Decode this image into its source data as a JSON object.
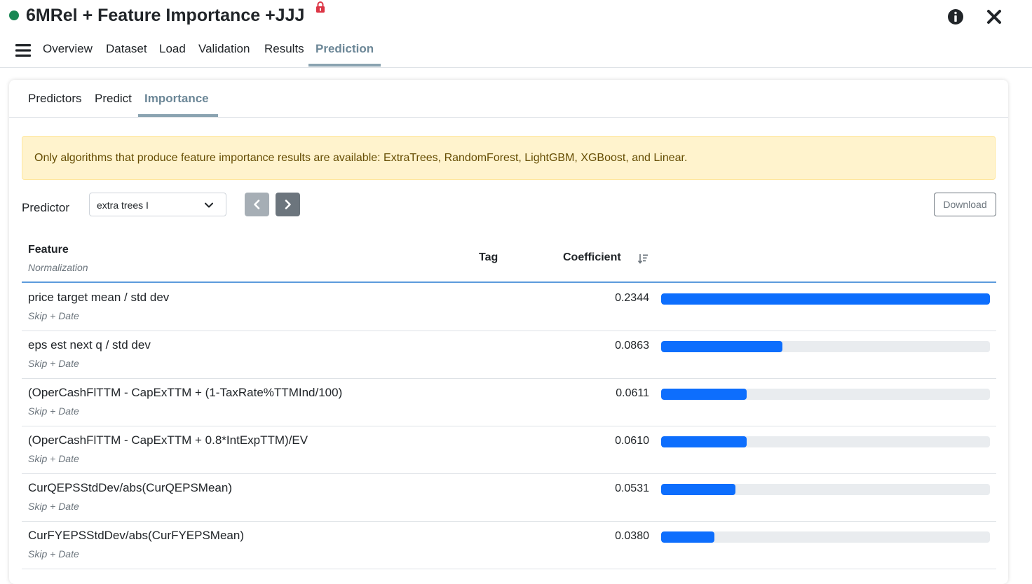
{
  "app": {
    "title": "6MRel + Feature Importance +JJJ",
    "status_color": "#198754",
    "icons": [
      "lock-icon",
      "info-icon",
      "close-icon",
      "menu-icon"
    ]
  },
  "main_nav": {
    "tabs": [
      {
        "label": "Overview"
      },
      {
        "label": "Dataset"
      },
      {
        "label": "Load"
      },
      {
        "label": "Validation"
      },
      {
        "label": "Results"
      },
      {
        "label": "Prediction",
        "active": true
      }
    ]
  },
  "sub_nav": {
    "tabs": [
      {
        "label": "Predictors"
      },
      {
        "label": "Predict"
      },
      {
        "label": "Importance",
        "active": true
      }
    ]
  },
  "alert": {
    "text": "Only algorithms that produce feature importance results are available: ExtraTrees, RandomForest, LightGBM, XGBoost, and Linear."
  },
  "controls": {
    "predictor_label": "Predictor",
    "predictor_value": "extra trees I",
    "download_label": "Download"
  },
  "table": {
    "headers": {
      "feature": "Feature",
      "normalization": "Normalization",
      "tag": "Tag",
      "coefficient": "Coefficient"
    },
    "rows": [
      {
        "feature": "price target mean / std dev",
        "normalization": "Skip + Date",
        "tag": "",
        "coefficient": "0.2344",
        "value": 0.2344
      },
      {
        "feature": "eps est next q / std dev",
        "normalization": "Skip + Date",
        "tag": "",
        "coefficient": "0.0863",
        "value": 0.0863
      },
      {
        "feature": "(OperCashFlTTM - CapExTTM + (1-TaxRate%TTMInd/100)",
        "normalization": "Skip + Date",
        "tag": "",
        "coefficient": "0.0611",
        "value": 0.0611
      },
      {
        "feature": "(OperCashFlTTM - CapExTTM + 0.8*IntExpTTM)/EV",
        "normalization": "Skip + Date",
        "tag": "",
        "coefficient": "0.0610",
        "value": 0.061
      },
      {
        "feature": "CurQEPSStdDev/abs(CurQEPSMean)",
        "normalization": "Skip + Date",
        "tag": "",
        "coefficient": "0.0531",
        "value": 0.0531
      },
      {
        "feature": "CurFYEPSStdDev/abs(CurFYEPSMean)",
        "normalization": "Skip + Date",
        "tag": "",
        "coefficient": "0.0380",
        "value": 0.038
      }
    ],
    "bar_color": "#0d6efd",
    "bar_track_color": "#e9ecef"
  }
}
